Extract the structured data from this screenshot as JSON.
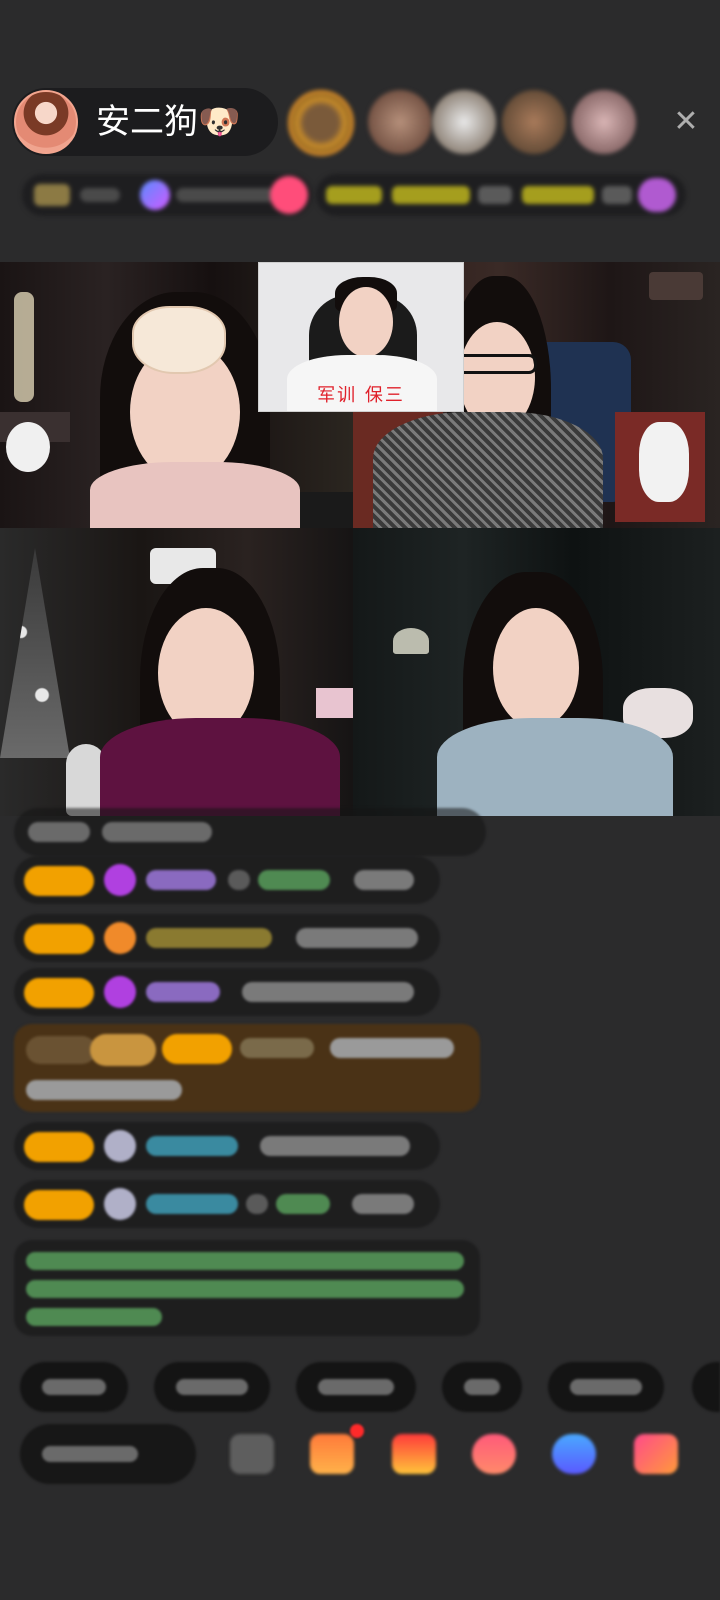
{
  "host": {
    "name": "安二狗",
    "emoji": "🐶"
  },
  "header": {
    "close_icon": "close-icon",
    "close_glyph": "✕"
  },
  "cohost": {
    "label": "军训 保三"
  },
  "colors": {
    "background": "#2b2b2c",
    "badge": "#f2a100",
    "accent_pink": "#ff4d7a",
    "chat_highlight": "#5a3a12"
  }
}
